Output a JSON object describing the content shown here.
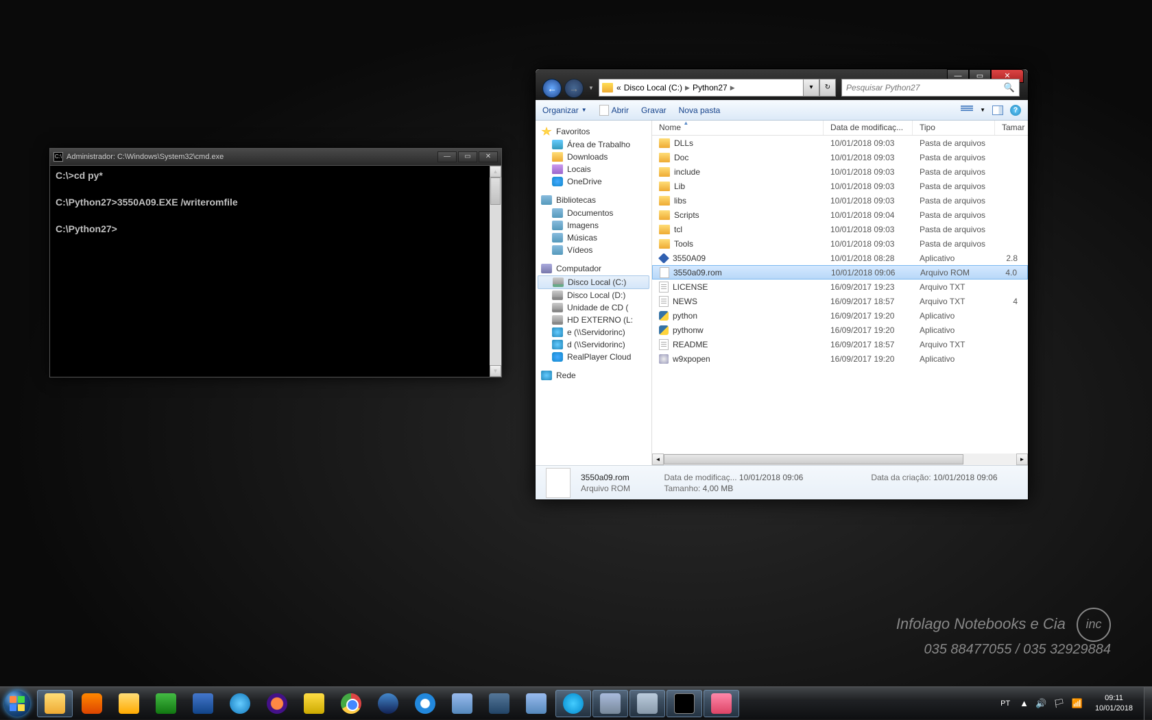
{
  "cmd": {
    "title": "Administrador: C:\\Windows\\System32\\cmd.exe",
    "lines": "C:\\>cd py*\n\nC:\\Python27>3550A09.EXE /writeromfile\n\nC:\\Python27>"
  },
  "explorer": {
    "breadcrumb1": "Disco Local (C:)",
    "breadcrumb2": "Python27",
    "search_ph": "Pesquisar Python27",
    "toolbar": {
      "organizar": "Organizar",
      "abrir": "Abrir",
      "gravar": "Gravar",
      "nova": "Nova pasta"
    },
    "sidebar": {
      "fav_head": "Favoritos",
      "fav": [
        "Área de Trabalho",
        "Downloads",
        "Locais",
        "OneDrive"
      ],
      "lib_head": "Bibliotecas",
      "lib": [
        "Documentos",
        "Imagens",
        "Músicas",
        "Vídeos"
      ],
      "comp_head": "Computador",
      "comp": [
        "Disco Local (C:)",
        "Disco Local (D:)",
        "Unidade de CD (",
        "HD EXTERNO (L:",
        "e (\\\\Servidorinc)",
        "d (\\\\Servidorinc)",
        "RealPlayer Cloud"
      ],
      "net_head": "Rede"
    },
    "cols": {
      "name": "Nome",
      "date": "Data de modificaç...",
      "type": "Tipo",
      "size": "Tamar"
    },
    "rows": [
      {
        "n": "DLLs",
        "d": "10/01/2018 09:03",
        "t": "Pasta de arquivos",
        "s": "",
        "k": "fold"
      },
      {
        "n": "Doc",
        "d": "10/01/2018 09:03",
        "t": "Pasta de arquivos",
        "s": "",
        "k": "fold"
      },
      {
        "n": "include",
        "d": "10/01/2018 09:03",
        "t": "Pasta de arquivos",
        "s": "",
        "k": "fold"
      },
      {
        "n": "Lib",
        "d": "10/01/2018 09:03",
        "t": "Pasta de arquivos",
        "s": "",
        "k": "fold"
      },
      {
        "n": "libs",
        "d": "10/01/2018 09:03",
        "t": "Pasta de arquivos",
        "s": "",
        "k": "fold"
      },
      {
        "n": "Scripts",
        "d": "10/01/2018 09:04",
        "t": "Pasta de arquivos",
        "s": "",
        "k": "fold"
      },
      {
        "n": "tcl",
        "d": "10/01/2018 09:03",
        "t": "Pasta de arquivos",
        "s": "",
        "k": "fold"
      },
      {
        "n": "Tools",
        "d": "10/01/2018 09:03",
        "t": "Pasta de arquivos",
        "s": "",
        "k": "fold"
      },
      {
        "n": "3550A09",
        "d": "10/01/2018 08:28",
        "t": "Aplicativo",
        "s": "2.8",
        "k": "diamond"
      },
      {
        "n": "3550a09.rom",
        "d": "10/01/2018 09:06",
        "t": "Arquivo ROM",
        "s": "4.0",
        "k": "file",
        "sel": true
      },
      {
        "n": "LICENSE",
        "d": "16/09/2017 19:23",
        "t": "Arquivo TXT",
        "s": "",
        "k": "txt"
      },
      {
        "n": "NEWS",
        "d": "16/09/2017 18:57",
        "t": "Arquivo TXT",
        "s": "4",
        "k": "txt"
      },
      {
        "n": "python",
        "d": "16/09/2017 19:20",
        "t": "Aplicativo",
        "s": "",
        "k": "py"
      },
      {
        "n": "pythonw",
        "d": "16/09/2017 19:20",
        "t": "Aplicativo",
        "s": "",
        "k": "py"
      },
      {
        "n": "README",
        "d": "16/09/2017 18:57",
        "t": "Arquivo TXT",
        "s": "",
        "k": "txt"
      },
      {
        "n": "w9xpopen",
        "d": "16/09/2017 19:20",
        "t": "Aplicativo",
        "s": "",
        "k": "exe"
      }
    ],
    "details": {
      "filename": "3550a09.rom",
      "filetype": "Arquivo ROM",
      "mod_lbl": "Data de modificaç...",
      "mod_val": "10/01/2018 09:06",
      "size_lbl": "Tamanho:",
      "size_val": "4,00 MB",
      "create_lbl": "Data da criação:",
      "create_val": "10/01/2018 09:06"
    }
  },
  "taskbar": {
    "lang": "PT",
    "time": "09:11",
    "date": "10/01/2018"
  },
  "watermark": {
    "brand": "Infolago Notebooks e Cia",
    "phones": "035 88477055 / 035 32929884",
    "logo": "inc"
  }
}
